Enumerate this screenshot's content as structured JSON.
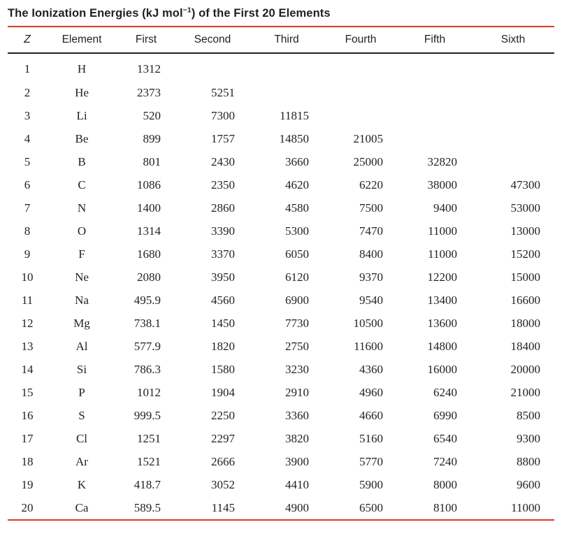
{
  "title": {
    "prefix": "The Ionization Energies (kJ mol",
    "superscript": "−1",
    "suffix": ") of the First 20 Elements",
    "full": "The Ionization Energies (kJ mol−1) of the First 20 Elements"
  },
  "colors": {
    "rule_red": "#d93d26",
    "rule_black": "#231f20",
    "text": "#231f20",
    "background": "#ffffff"
  },
  "chart_data": {
    "type": "table",
    "title": "The Ionization Energies (kJ mol−1) of the First 20 Elements",
    "units": "kJ mol−1",
    "columns": [
      "Z",
      "Element",
      "First",
      "Second",
      "Third",
      "Fourth",
      "Fifth",
      "Sixth"
    ],
    "rows": [
      [
        "1",
        "H",
        "1312",
        "",
        "",
        "",
        "",
        ""
      ],
      [
        "2",
        "He",
        "2373",
        "5251",
        "",
        "",
        "",
        ""
      ],
      [
        "3",
        "Li",
        "520",
        "7300",
        "11815",
        "",
        "",
        ""
      ],
      [
        "4",
        "Be",
        "899",
        "1757",
        "14850",
        "21005",
        "",
        ""
      ],
      [
        "5",
        "B",
        "801",
        "2430",
        "3660",
        "25000",
        "32820",
        ""
      ],
      [
        "6",
        "C",
        "1086",
        "2350",
        "4620",
        "6220",
        "38000",
        "47300"
      ],
      [
        "7",
        "N",
        "1400",
        "2860",
        "4580",
        "7500",
        "9400",
        "53000"
      ],
      [
        "8",
        "O",
        "1314",
        "3390",
        "5300",
        "7470",
        "11000",
        "13000"
      ],
      [
        "9",
        "F",
        "1680",
        "3370",
        "6050",
        "8400",
        "11000",
        "15200"
      ],
      [
        "10",
        "Ne",
        "2080",
        "3950",
        "6120",
        "9370",
        "12200",
        "15000"
      ],
      [
        "11",
        "Na",
        "495.9",
        "4560",
        "6900",
        "9540",
        "13400",
        "16600"
      ],
      [
        "12",
        "Mg",
        "738.1",
        "1450",
        "7730",
        "10500",
        "13600",
        "18000"
      ],
      [
        "13",
        "Al",
        "577.9",
        "1820",
        "2750",
        "11600",
        "14800",
        "18400"
      ],
      [
        "14",
        "Si",
        "786.3",
        "1580",
        "3230",
        "4360",
        "16000",
        "20000"
      ],
      [
        "15",
        "P",
        "1012",
        "1904",
        "2910",
        "4960",
        "6240",
        "21000"
      ],
      [
        "16",
        "S",
        "999.5",
        "2250",
        "3360",
        "4660",
        "6990",
        "8500"
      ],
      [
        "17",
        "Cl",
        "1251",
        "2297",
        "3820",
        "5160",
        "6540",
        "9300"
      ],
      [
        "18",
        "Ar",
        "1521",
        "2666",
        "3900",
        "5770",
        "7240",
        "8800"
      ],
      [
        "19",
        "K",
        "418.7",
        "3052",
        "4410",
        "5900",
        "8000",
        "9600"
      ],
      [
        "20",
        "Ca",
        "589.5",
        "1145",
        "4900",
        "6500",
        "8100",
        "11000"
      ]
    ]
  }
}
